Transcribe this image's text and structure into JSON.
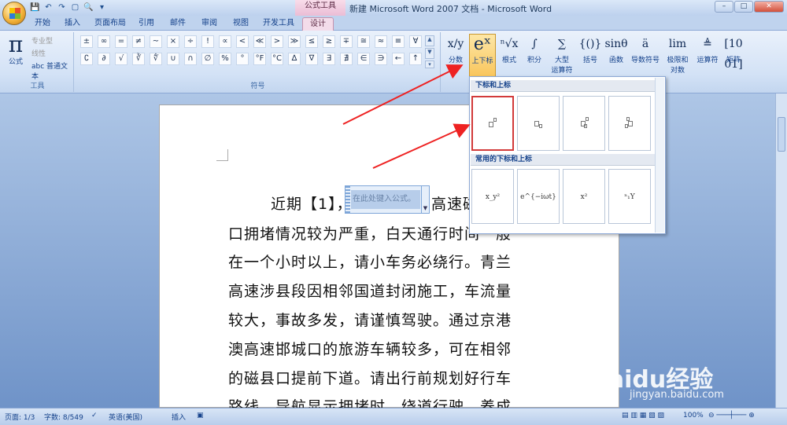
{
  "window": {
    "title": "新建 Microsoft Word 2007 文档 - Microsoft Word",
    "context_tab": "公式工具",
    "controls": [
      "–",
      "□",
      "✕"
    ]
  },
  "quick_access": [
    "💾",
    "↶",
    "↷",
    "▢",
    "🔍",
    "▾"
  ],
  "tabs": [
    "开始",
    "插入",
    "页面布局",
    "引用",
    "邮件",
    "审阅",
    "视图",
    "开发工具",
    "设计"
  ],
  "active_tab": "设计",
  "ribbon": {
    "tools": {
      "label": "工具",
      "equation": "公式",
      "options": [
        "专业型",
        "线性",
        "abc 普通文本"
      ]
    },
    "symbols": {
      "label": "符号",
      "row1": [
        "±",
        "∞",
        "=",
        "≠",
        "~",
        "×",
        "÷",
        "!",
        "∝",
        "<",
        "≪",
        ">",
        "≫",
        "≤",
        "≥",
        "∓",
        "≅",
        "≈",
        "≡",
        "∀"
      ],
      "row2": [
        "∁",
        "∂",
        "√",
        "∛",
        "∜",
        "∪",
        "∩",
        "∅",
        "%",
        "°",
        "°F",
        "°C",
        "∆",
        "∇",
        "∃",
        "∄",
        "∈",
        "∋",
        "←",
        "↑"
      ]
    },
    "structures": [
      {
        "icon": "x/y",
        "label": "分数"
      },
      {
        "icon": "eˣ",
        "label": "上下标"
      },
      {
        "icon": "ⁿ√x",
        "label": "根式"
      },
      {
        "icon": "∫",
        "label": "积分"
      },
      {
        "icon": "∑",
        "label": "大型\n运算符"
      },
      {
        "icon": "{()}",
        "label": "括号"
      },
      {
        "icon": "sinθ",
        "label": "函数"
      },
      {
        "icon": "ä",
        "label": "导数符号"
      },
      {
        "icon": "lim",
        "label": "极限和\n对数"
      },
      {
        "icon": "≜",
        "label": "运算符"
      },
      {
        "icon": "[10 01]",
        "label": "矩阵"
      }
    ]
  },
  "dropdown": {
    "section1": "下标和上标",
    "section2": "常用的下标和上标",
    "templates": [
      "x^□",
      "x_□",
      "x_□^□",
      "□_□^□x"
    ],
    "common": [
      "x_y²",
      "e^{−iωt}",
      "x²",
      "ⁿ₁Y"
    ]
  },
  "document": {
    "lines": [
      "近期【1】，",
      "高速磁",
      "口拥堵情况较为严重，白天通行时间一般",
      "在一个小时以上，请小车务必绕行。青兰",
      "高速涉县段因相邻国道封闭施工，车流量",
      "较大，事故多发，请谨慎驾驶。通过京港",
      "澳高速邯城口的旅游车辆较多，可在相邻",
      "的磁县口提前下道。请出行前规划好行车",
      "路线，导航显示拥堵时，绕道行驶，养成"
    ],
    "equation_placeholder": "在此处键入公式。"
  },
  "statusbar": {
    "page": "页面: 1/3",
    "words": "字数: 8/549",
    "language": "英语(美国)",
    "mode": "插入",
    "zoom": "100%"
  },
  "watermark": {
    "brand": "Baidu经验",
    "url": "jingyan.baidu.com"
  }
}
